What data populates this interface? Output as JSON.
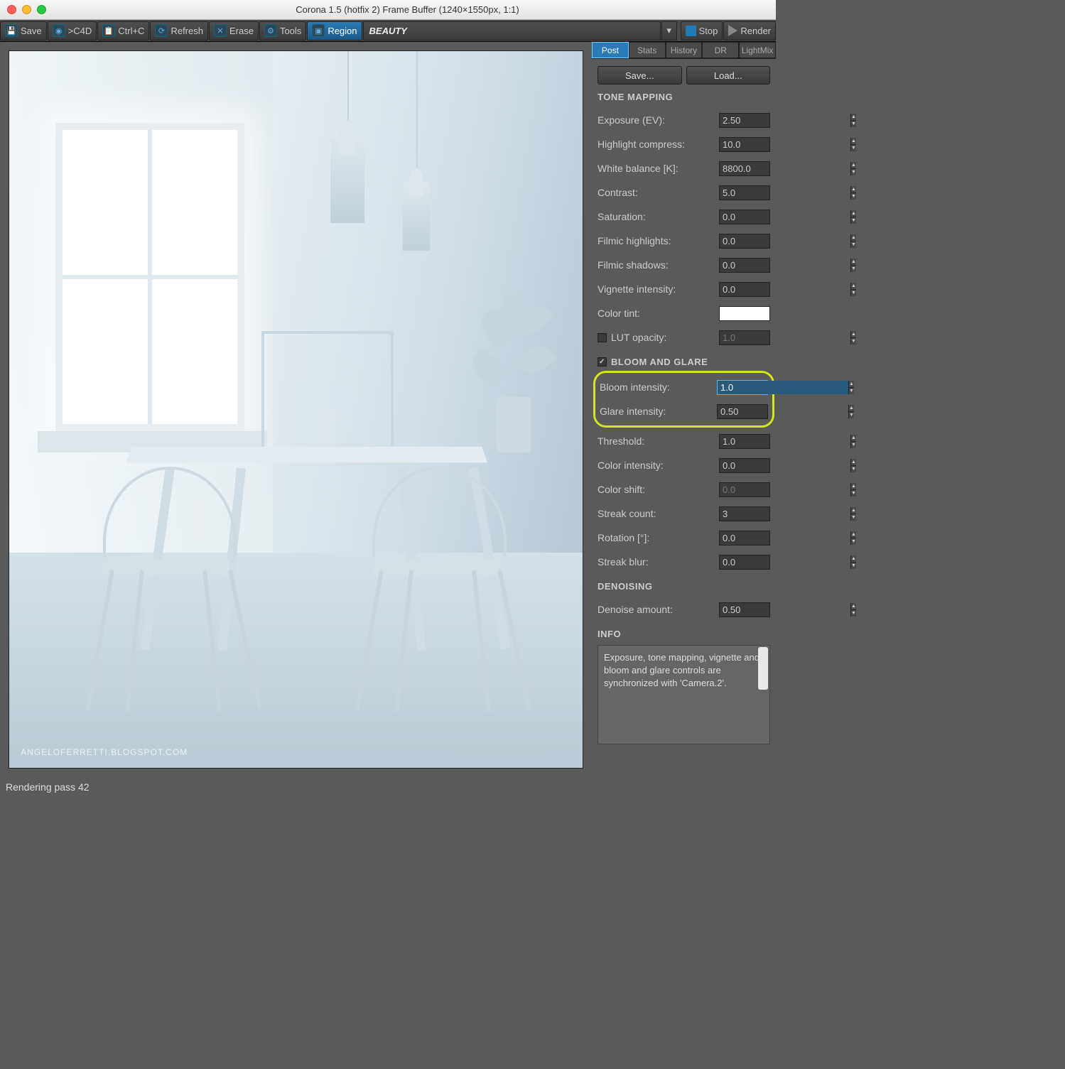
{
  "window": {
    "title": "Corona 1.5 (hotfix 2) Frame Buffer (1240×1550px, 1:1)"
  },
  "toolbar": {
    "save": "Save",
    "c4d": ">C4D",
    "ctrlc": "Ctrl+C",
    "refresh": "Refresh",
    "erase": "Erase",
    "tools": "Tools",
    "region": "Region",
    "pass": "BEAUTY",
    "stop": "Stop",
    "render": "Render"
  },
  "viewport": {
    "watermark": "ANGELOFERRETTI.BLOGSPOT.COM"
  },
  "statusbar": {
    "text": "Rendering pass 42"
  },
  "tabs": [
    "Post",
    "Stats",
    "History",
    "DR",
    "LightMix"
  ],
  "buttons": {
    "save": "Save...",
    "load": "Load..."
  },
  "sections": {
    "toneMapping": "TONE MAPPING",
    "bloomGlare": "BLOOM AND GLARE",
    "denoising": "DENOISING",
    "info": "INFO"
  },
  "params": {
    "exposure": {
      "label": "Exposure (EV):",
      "value": "2.50"
    },
    "highlight": {
      "label": "Highlight compress:",
      "value": "10.0"
    },
    "wb": {
      "label": "White balance [K]:",
      "value": "8800.0"
    },
    "contrast": {
      "label": "Contrast:",
      "value": "5.0"
    },
    "saturation": {
      "label": "Saturation:",
      "value": "0.0"
    },
    "filmicH": {
      "label": "Filmic highlights:",
      "value": "0.0"
    },
    "filmicS": {
      "label": "Filmic shadows:",
      "value": "0.0"
    },
    "vignette": {
      "label": "Vignette intensity:",
      "value": "0.0"
    },
    "colortint": {
      "label": "Color tint:"
    },
    "lut": {
      "label": "LUT opacity:",
      "value": "1.0"
    },
    "bloomInt": {
      "label": "Bloom intensity:",
      "value": "1.0"
    },
    "glareInt": {
      "label": "Glare intensity:",
      "value": "0.50"
    },
    "threshold": {
      "label": "Threshold:",
      "value": "1.0"
    },
    "colorInt": {
      "label": "Color intensity:",
      "value": "0.0"
    },
    "colorShift": {
      "label": "Color shift:",
      "value": "0.0"
    },
    "streak": {
      "label": "Streak count:",
      "value": "3"
    },
    "rotation": {
      "label": "Rotation [°]:",
      "value": "0.0"
    },
    "streakBlur": {
      "label": "Streak blur:",
      "value": "0.0"
    },
    "denoise": {
      "label": "Denoise amount:",
      "value": "0.50"
    }
  },
  "info": {
    "text": "Exposure, tone mapping, vignette and bloom and glare controls are synchronized with 'Camera.2'."
  }
}
